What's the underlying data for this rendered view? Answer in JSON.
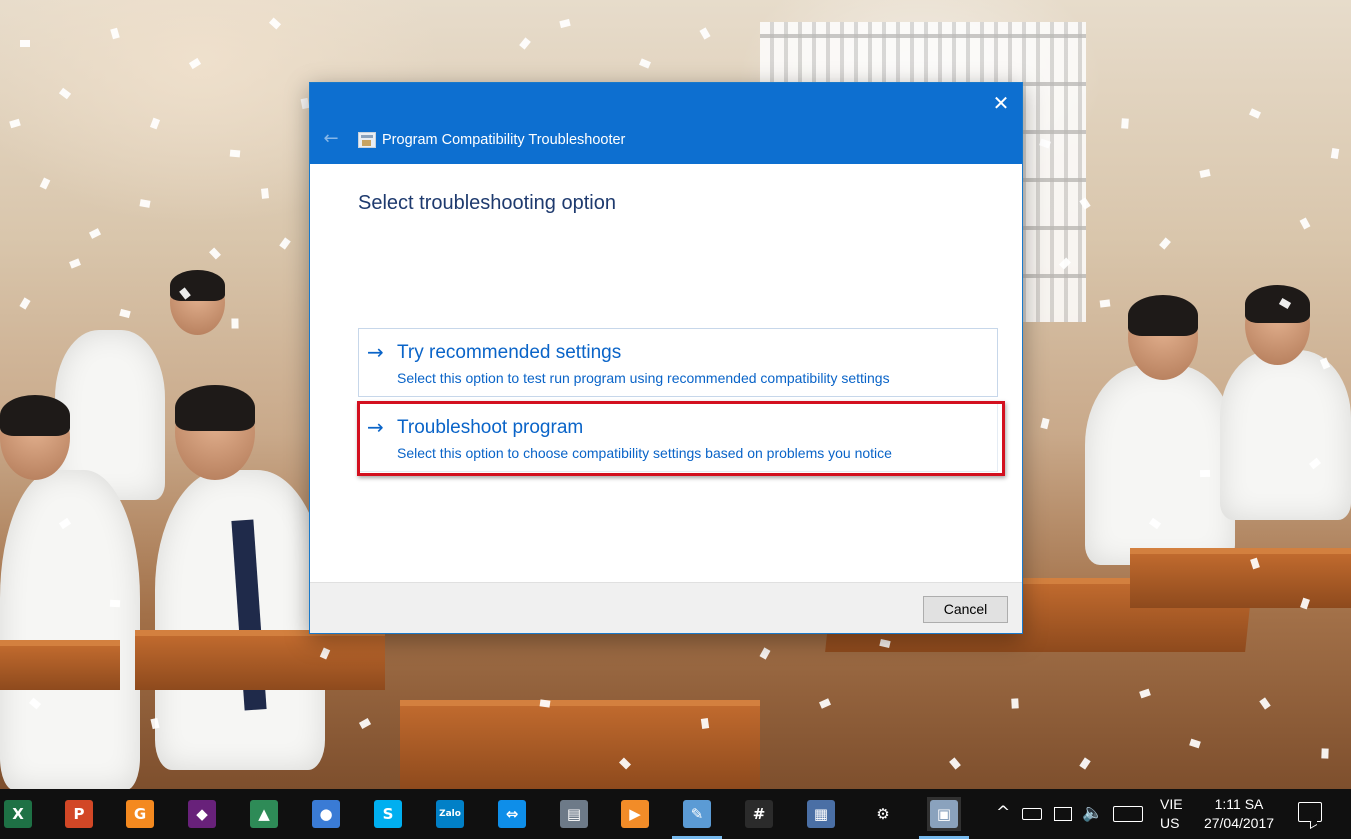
{
  "dialog": {
    "title": "Program Compatibility Troubleshooter",
    "heading": "Select troubleshooting option",
    "options": [
      {
        "title": "Try recommended settings",
        "description": "Select this option to test run program using recommended compatibility settings"
      },
      {
        "title": "Troubleshoot program",
        "description": "Select this option to choose compatibility settings based on problems you notice"
      }
    ],
    "cancel_label": "Cancel",
    "close_symbol": "✕",
    "back_symbol": "←",
    "arrow_symbol": "→",
    "accent_color": "#0d6fd0",
    "link_color": "#0a64c8",
    "highlight_color": "#d3101f"
  },
  "taskbar": {
    "apps": [
      {
        "name": "excel-icon",
        "glyph": "X",
        "color": "#1e7145"
      },
      {
        "name": "powerpoint-icon",
        "glyph": "P",
        "color": "#d24726"
      },
      {
        "name": "pdf-reader-icon",
        "glyph": "G",
        "color": "#f4891f"
      },
      {
        "name": "visual-studio-icon",
        "glyph": "◆",
        "color": "#68217a"
      },
      {
        "name": "drawing-app-icon",
        "glyph": "▲",
        "color": "#2e8b57"
      },
      {
        "name": "internet-download-manager-icon",
        "glyph": "●",
        "color": "#3a7bd5"
      },
      {
        "name": "skype-icon",
        "glyph": "S",
        "color": "#00aff0"
      },
      {
        "name": "zalo-icon",
        "glyph": "Zalo",
        "color": "#0180c7"
      },
      {
        "name": "teamviewer-icon",
        "glyph": "⇔",
        "color": "#0e8ee9"
      },
      {
        "name": "network-tool-icon",
        "glyph": "▤",
        "color": "#6d7a88"
      },
      {
        "name": "media-player-icon",
        "glyph": "▶",
        "color": "#f28c28"
      },
      {
        "name": "notepad-icon",
        "glyph": "✎",
        "color": "#5b9bd5"
      },
      {
        "name": "slack-icon",
        "glyph": "#",
        "color": "#2b2b2b"
      },
      {
        "name": "calculator-icon",
        "glyph": "▦",
        "color": "#4a6fa5"
      },
      {
        "name": "settings-icon",
        "glyph": "⚙",
        "color": "#101010"
      },
      {
        "name": "troubleshooter-icon",
        "glyph": "▣",
        "color": "#8aa2bd"
      }
    ],
    "tray": {
      "chevron": "^",
      "language_line1": "VIE",
      "language_line2": "US",
      "time": "1:11 SA",
      "date": "27/04/2017"
    }
  }
}
